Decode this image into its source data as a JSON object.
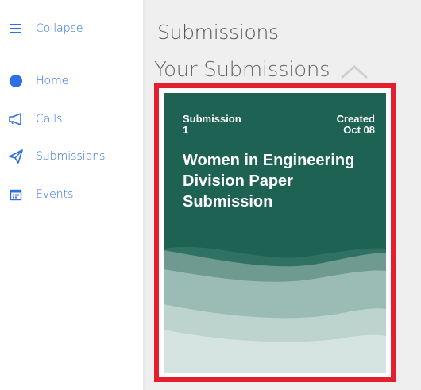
{
  "sidebar": {
    "items": [
      {
        "label": "Collapse",
        "icon": "menu-icon"
      },
      {
        "label": "Home",
        "icon": "home-icon"
      },
      {
        "label": "Calls",
        "icon": "megaphone-icon"
      },
      {
        "label": "Submissions",
        "icon": "paper-plane-icon"
      },
      {
        "label": "Events",
        "icon": "calendar-icon"
      }
    ]
  },
  "main": {
    "title": "Submissions",
    "section_title": "Your Submissions",
    "section_toggle_icon": "chevron-up-icon"
  },
  "card": {
    "submission_label": "Submission",
    "submission_number": "1",
    "created_label": "Created",
    "created_date": "Oct 08",
    "title": "Women in Engineering Division Paper Submission"
  },
  "colors": {
    "accent": "#2f6fe4",
    "card_bg": "#1e6254",
    "highlight_border": "#e41e2a",
    "main_bg": "#efefef"
  }
}
